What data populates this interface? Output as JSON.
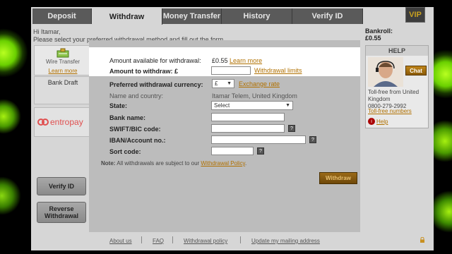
{
  "tabs": [
    "Deposit",
    "Withdraw",
    "Money Transfer",
    "History",
    "Verify ID"
  ],
  "vip_label": "VIP",
  "greeting": {
    "line1": "Hi Itamar,",
    "line2": "Please select your preferred withdrawal method and fill out the form"
  },
  "methods": {
    "wire_label": "Wire Transfer",
    "wire_learn_more": "Learn more",
    "bank_draft": "Bank Draft",
    "entropay": "entropay"
  },
  "side_buttons": {
    "verify": "Verify ID",
    "reverse_line1": "Reverse",
    "reverse_line2": "Withdrawal"
  },
  "form": {
    "amount_available_label": "Amount available for withdrawal:",
    "amount_available_value": "£0.55",
    "learn_more": "Learn more",
    "amount_label": "Amount to withdraw: £",
    "amount_value": "",
    "withdrawal_limits": "Withdrawal limits",
    "currency_label": "Preferred withdrawal currency:",
    "currency_value": "£",
    "exchange_rate": "Exchange rate",
    "name_label": "Name and country:",
    "name_value": "Itamar Telem, United Kingdom",
    "state_label": "State:",
    "state_value": "Select",
    "bank_name_label": "Bank name:",
    "swift_label": "SWIFT/BIC code:",
    "iban_label": "IBAN/Account no.:",
    "sort_label": "Sort code:",
    "q": "?"
  },
  "note": {
    "prefix": "Note:",
    "text": " All withdrawals are subject to our ",
    "link": "Withdrawal Policy",
    "suffix": "."
  },
  "withdraw_button": "Withdraw",
  "footer": [
    "About us",
    "FAQ",
    "Withdrawal policy",
    "Update my mailing address"
  ],
  "bankroll": {
    "label": "Bankroll:",
    "value": "£0.55"
  },
  "help": {
    "title": "HELP",
    "chat": "Chat",
    "tollfree_line1": "Toll-free from United",
    "tollfree_line2": "Kingdom",
    "phone": "0800-279-2992",
    "tollfree_numbers": "Toll-free numbers",
    "help_link": "Help",
    "help_icon_char": "i"
  },
  "colors": {
    "accent": "#b07000",
    "background_glow": "#7cd000"
  }
}
